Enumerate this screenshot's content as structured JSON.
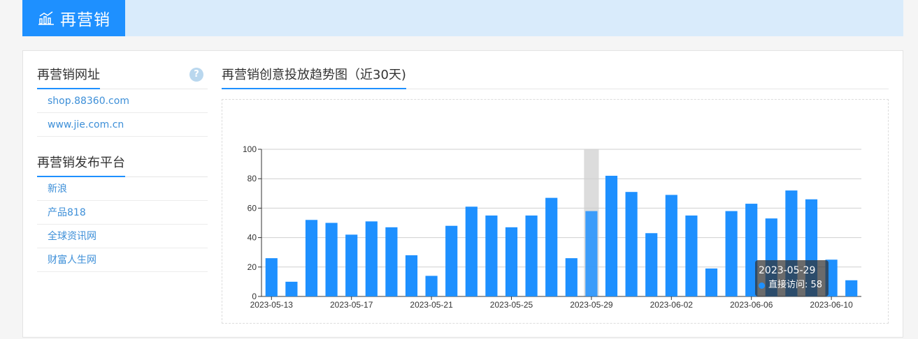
{
  "header": {
    "title": "再营销"
  },
  "sidebar": {
    "urls_title": "再营销网址",
    "help_symbol": "?",
    "urls": [
      {
        "label": "shop.88360.com"
      },
      {
        "label": "www.jie.com.cn"
      }
    ],
    "platforms_title": "再营销发布平台",
    "platforms": [
      {
        "label": "新浪"
      },
      {
        "label": "产品818"
      },
      {
        "label": "全球资讯网"
      },
      {
        "label": "财富人生网"
      }
    ]
  },
  "main": {
    "chart_title": "再营销创意投放趋势图（近30天)"
  },
  "colors": {
    "accent": "#1e90ff",
    "header_bg": "#d9ebfb"
  },
  "chart_data": {
    "type": "bar",
    "x": [
      "2023-05-13",
      "2023-05-14",
      "2023-05-15",
      "2023-05-16",
      "2023-05-17",
      "2023-05-18",
      "2023-05-19",
      "2023-05-20",
      "2023-05-21",
      "2023-05-22",
      "2023-05-23",
      "2023-05-24",
      "2023-05-25",
      "2023-05-26",
      "2023-05-27",
      "2023-05-28",
      "2023-05-29",
      "2023-05-30",
      "2023-05-31",
      "2023-06-01",
      "2023-06-02",
      "2023-06-03",
      "2023-06-04",
      "2023-06-05",
      "2023-06-06",
      "2023-06-07",
      "2023-06-08",
      "2023-06-09",
      "2023-06-10",
      "2023-06-11"
    ],
    "x_tick_labels": [
      "2023-05-13",
      "2023-05-17",
      "2023-05-21",
      "2023-05-25",
      "2023-05-29",
      "2023-06-02",
      "2023-06-06",
      "2023-06-10"
    ],
    "series": [
      {
        "name": "直接访问",
        "values": [
          26,
          10,
          52,
          50,
          42,
          51,
          47,
          28,
          14,
          48,
          61,
          55,
          47,
          55,
          67,
          26,
          58,
          82,
          71,
          43,
          69,
          55,
          19,
          58,
          63,
          53,
          72,
          66,
          25,
          11
        ]
      }
    ],
    "ylim": [
      0,
      100
    ],
    "yticks": [
      0,
      20,
      40,
      60,
      80,
      100
    ],
    "grid": true,
    "highlight": {
      "date": "2023-05-29",
      "label": "直接访问",
      "value": 58
    }
  }
}
